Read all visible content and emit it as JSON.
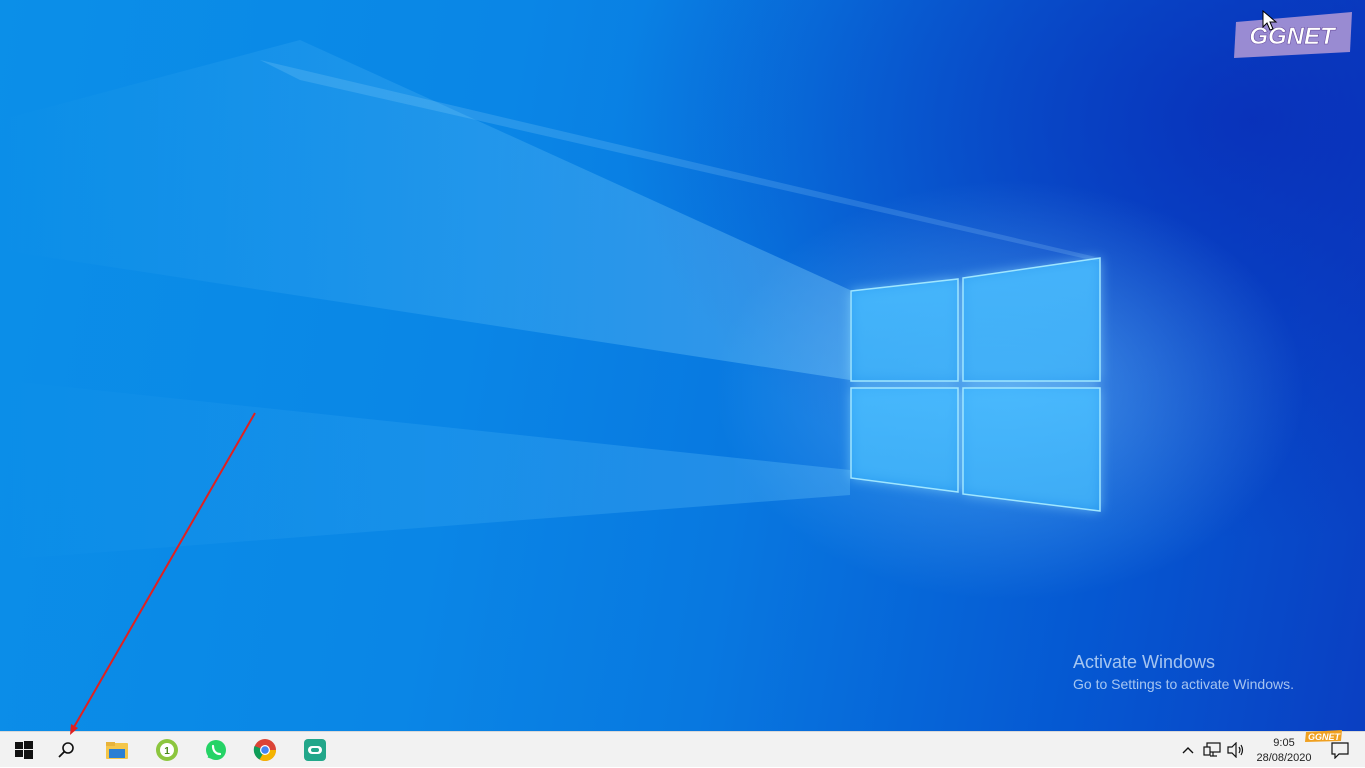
{
  "desktop": {
    "activation": {
      "title": "Activate Windows",
      "subtitle": "Go to Settings to activate Windows."
    },
    "watermark_logo": "GGNET",
    "colors": {
      "accent": "#0a86e6",
      "annotation_arrow": "#e02020"
    }
  },
  "taskbar": {
    "buttons": [
      {
        "name": "start",
        "icon": "windows-icon"
      },
      {
        "name": "search",
        "icon": "search-icon"
      },
      {
        "name": "file-explorer",
        "icon": "folder-icon"
      },
      {
        "name": "app-green",
        "icon": "green-circle-icon"
      },
      {
        "name": "whatsapp",
        "icon": "whatsapp-icon"
      },
      {
        "name": "chrome",
        "icon": "chrome-icon"
      },
      {
        "name": "app-teal",
        "icon": "teal-app-icon"
      }
    ],
    "tray": {
      "icons": [
        "chevron-up-icon",
        "network-icon",
        "volume-icon",
        "notification-icon"
      ]
    },
    "clock": {
      "time": "9:05",
      "date": "28/08/2020",
      "badge": "GGNET"
    }
  }
}
